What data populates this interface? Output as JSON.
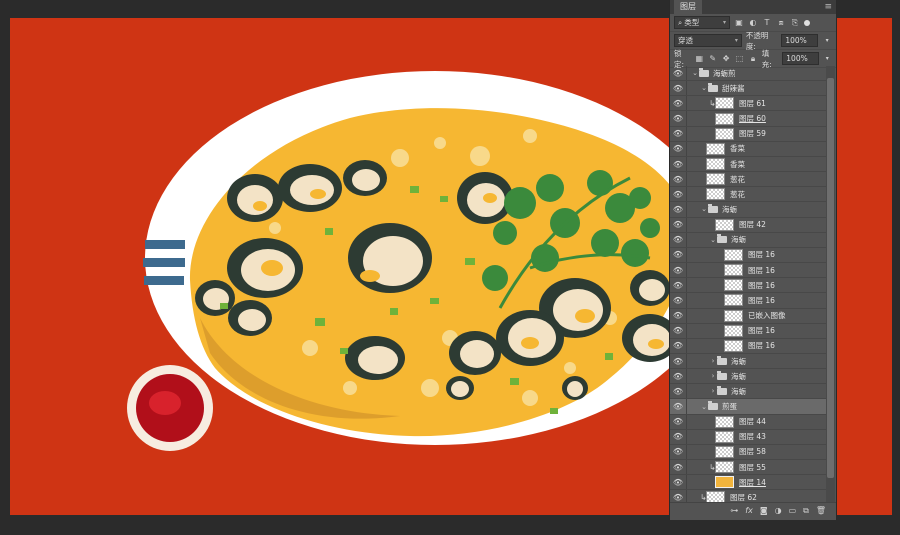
{
  "panel": {
    "tab_label": "图层",
    "filter_label": "类型",
    "blend_mode": "穿透",
    "opacity_label": "不透明度:",
    "opacity_value": "100%",
    "lock_label": "锁定:",
    "fill_label": "填充:",
    "fill_value": "100%"
  },
  "layers": [
    {
      "name": "海蛎煎",
      "type": "group",
      "indent": 0,
      "expanded": true,
      "clip": false,
      "thumb": "none",
      "selected": false,
      "underline": false
    },
    {
      "name": "甜辣酱",
      "type": "group",
      "indent": 1,
      "expanded": true,
      "clip": false,
      "thumb": "none",
      "selected": false,
      "underline": false
    },
    {
      "name": "图层 61",
      "type": "layer",
      "indent": 2,
      "clip": true,
      "thumb": "transparent",
      "selected": false,
      "underline": false
    },
    {
      "name": "图层 60",
      "type": "layer",
      "indent": 2,
      "clip": false,
      "thumb": "transparent",
      "selected": false,
      "underline": true
    },
    {
      "name": "图层 59",
      "type": "layer",
      "indent": 2,
      "clip": false,
      "thumb": "transparent",
      "selected": false,
      "underline": false
    },
    {
      "name": "香菜",
      "type": "layer",
      "indent": 1,
      "clip": false,
      "thumb": "transparent",
      "selected": false,
      "underline": false
    },
    {
      "name": "香菜",
      "type": "layer",
      "indent": 1,
      "clip": false,
      "thumb": "transparent",
      "selected": false,
      "underline": false
    },
    {
      "name": "葱花",
      "type": "layer",
      "indent": 1,
      "clip": false,
      "thumb": "transparent",
      "selected": false,
      "underline": false
    },
    {
      "name": "葱花",
      "type": "layer",
      "indent": 1,
      "clip": false,
      "thumb": "transparent",
      "selected": false,
      "underline": false
    },
    {
      "name": "海蛎",
      "type": "group",
      "indent": 1,
      "expanded": true,
      "clip": false,
      "thumb": "none",
      "selected": false,
      "underline": false
    },
    {
      "name": "图层 42",
      "type": "layer",
      "indent": 2,
      "clip": false,
      "thumb": "transparent",
      "selected": false,
      "underline": false
    },
    {
      "name": "海蛎",
      "type": "group",
      "indent": 2,
      "expanded": true,
      "clip": false,
      "thumb": "none",
      "selected": false,
      "underline": false
    },
    {
      "name": "图层 16",
      "type": "layer",
      "indent": 3,
      "clip": false,
      "thumb": "transparent",
      "selected": false,
      "underline": false
    },
    {
      "name": "图层 16",
      "type": "layer",
      "indent": 3,
      "clip": false,
      "thumb": "transparent",
      "selected": false,
      "underline": false
    },
    {
      "name": "图层 16",
      "type": "layer",
      "indent": 3,
      "clip": false,
      "thumb": "transparent",
      "selected": false,
      "underline": false
    },
    {
      "name": "图层 16",
      "type": "layer",
      "indent": 3,
      "clip": false,
      "thumb": "transparent",
      "selected": false,
      "underline": false
    },
    {
      "name": "已嵌入图像",
      "type": "layer",
      "indent": 3,
      "clip": false,
      "thumb": "transparent",
      "selected": false,
      "underline": false
    },
    {
      "name": "图层 16",
      "type": "layer",
      "indent": 3,
      "clip": false,
      "thumb": "transparent",
      "selected": false,
      "underline": false
    },
    {
      "name": "图层 16",
      "type": "layer",
      "indent": 3,
      "clip": false,
      "thumb": "transparent",
      "selected": false,
      "underline": false
    },
    {
      "name": "海蛎",
      "type": "group",
      "indent": 2,
      "expanded": false,
      "clip": false,
      "thumb": "none",
      "selected": false,
      "underline": false
    },
    {
      "name": "海蛎",
      "type": "group",
      "indent": 2,
      "expanded": false,
      "clip": false,
      "thumb": "none",
      "selected": false,
      "underline": false
    },
    {
      "name": "海蛎",
      "type": "group",
      "indent": 2,
      "expanded": false,
      "clip": false,
      "thumb": "none",
      "selected": false,
      "underline": false
    },
    {
      "name": "煎蛋",
      "type": "group",
      "indent": 1,
      "expanded": true,
      "clip": false,
      "thumb": "none",
      "selected": true,
      "underline": false
    },
    {
      "name": "图层 44",
      "type": "layer",
      "indent": 2,
      "clip": false,
      "thumb": "transparent",
      "selected": false,
      "underline": false
    },
    {
      "name": "图层 43",
      "type": "layer",
      "indent": 2,
      "clip": false,
      "thumb": "transparent",
      "selected": false,
      "underline": false
    },
    {
      "name": "图层 58",
      "type": "layer",
      "indent": 2,
      "clip": false,
      "thumb": "transparent",
      "selected": false,
      "underline": false
    },
    {
      "name": "图层 55",
      "type": "layer",
      "indent": 2,
      "clip": true,
      "thumb": "transparent",
      "selected": false,
      "underline": false
    },
    {
      "name": "图层 14",
      "type": "layer",
      "indent": 2,
      "clip": false,
      "thumb": "orange",
      "selected": false,
      "underline": true
    },
    {
      "name": "图层 62",
      "type": "layer",
      "indent": 1,
      "clip": true,
      "thumb": "transparent",
      "selected": false,
      "underline": false
    }
  ],
  "footer_icons": [
    "link-icon",
    "fx-icon",
    "mask-icon",
    "adjustment-icon",
    "folder-icon",
    "new-layer-icon",
    "trash-icon"
  ],
  "colors": {
    "background": "#cf3414",
    "plate": "#ffffff",
    "plate_stripe": "#3d6a8e",
    "egg": "#f6b732",
    "oyster_shell": "#2d3b33",
    "oyster_flesh": "#f3e3c6",
    "cilantro": "#3b8a3c",
    "sauce": "#b10f1a"
  }
}
